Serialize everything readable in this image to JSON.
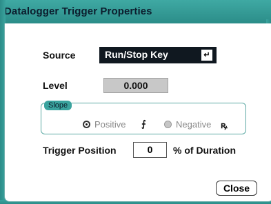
{
  "window": {
    "title": "Datalogger Trigger Properties"
  },
  "source": {
    "label": "Source",
    "value": "Run/Stop Key",
    "icon": "enter-icon"
  },
  "level": {
    "label": "Level",
    "value": "0.000"
  },
  "slope": {
    "group_label": "Slope",
    "options": [
      {
        "label": "Positive",
        "selected": true,
        "icon": "rising-edge-icon"
      },
      {
        "label": "Negative",
        "selected": false,
        "icon": "falling-edge-icon"
      }
    ]
  },
  "trigger_position": {
    "label": "Trigger Position",
    "value": "0",
    "unit_label": "% of Duration"
  },
  "buttons": {
    "close": "Close"
  },
  "colors": {
    "accent": "#3aa39e",
    "dark_input": "#101820",
    "disabled_input": "#c8c8c8"
  }
}
